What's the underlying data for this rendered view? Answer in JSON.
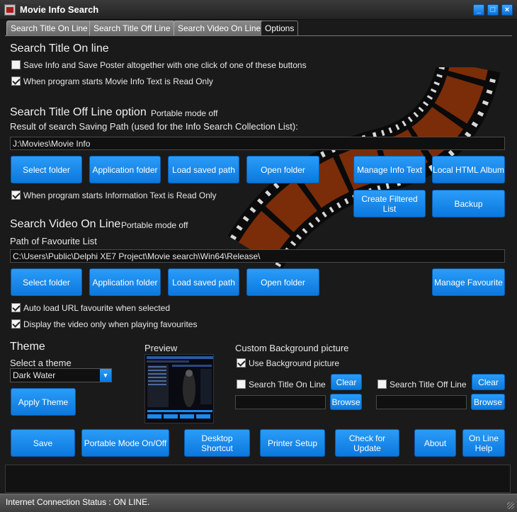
{
  "window": {
    "title": "Movie Info Search",
    "min_glyph": "_",
    "max_glyph": "□",
    "close_glyph": "×"
  },
  "tabs": [
    {
      "label": "Search Title On Line"
    },
    {
      "label": "Search Title Off Line"
    },
    {
      "label": "Search Video On Line"
    },
    {
      "label": "Options"
    }
  ],
  "online": {
    "heading": "Search Title On line",
    "opt1": {
      "label": "Save Info and Save Poster altogether with one click of one of these buttons",
      "checked": false
    },
    "opt2": {
      "label": "When program starts Movie Info Text is Read Only",
      "checked": true
    }
  },
  "offline": {
    "heading": "Search Title Off Line option",
    "mode": "Portable mode off",
    "path_label": "Result of search Saving Path (used for the Info Search Collection List):",
    "path_value": "J:\\Movies\\Movie Info",
    "buttons": {
      "select": "Select folder",
      "application": "Application folder",
      "load": "Load saved path",
      "open": "Open folder",
      "manage_info": "Manage Info Text",
      "html_album": "Local HTML Album",
      "filtered": "Create Filtered List",
      "backup": "Backup"
    },
    "opt_readonly": {
      "label": "When program starts Information Text is Read Only",
      "checked": true
    }
  },
  "video": {
    "heading": "Search Video On Line",
    "mode": "Portable mode off",
    "path_label": "Path of Favourite List",
    "path_value": "C:\\Users\\Public\\Delphi XE7 Project\\Movie search\\Win64\\Release\\",
    "buttons": {
      "select": "Select folder",
      "application": "Application folder",
      "load": "Load saved path",
      "open": "Open folder",
      "manage_fav": "Manage Favourite"
    },
    "opt_autoload": {
      "label": "Auto load URL favourite when selected",
      "checked": true
    },
    "opt_display": {
      "label": "Display the video only when playing favourites",
      "checked": true
    }
  },
  "theme": {
    "heading": "Theme",
    "select_label": "Select a theme",
    "selected": "Dark Water",
    "apply": "Apply Theme",
    "preview_label": "Preview"
  },
  "custom_bg": {
    "heading": "Custom Background picture",
    "use_bg": {
      "label": "Use Background picture",
      "checked": true
    },
    "online": {
      "label": "Search Title On Line",
      "checked": false,
      "clear": "Clear",
      "browse": "Browse",
      "value": ""
    },
    "offline": {
      "label": "Search Title Off Line",
      "checked": false,
      "clear": "Clear",
      "browse": "Browse",
      "value": ""
    }
  },
  "bottom_buttons": {
    "save": "Save",
    "portable": "Portable Mode On/Off",
    "desktop": "Desktop Shortcut",
    "printer": "Printer Setup",
    "update": "Check for Update",
    "about": "About",
    "help_line1": "On Line",
    "help_line2": "Help"
  },
  "status": {
    "text": "Internet Connection Status : ON LINE."
  },
  "colors": {
    "button": "#1a8aef",
    "background": "#1a1a1a",
    "film_frame": "#6a2a0a"
  }
}
